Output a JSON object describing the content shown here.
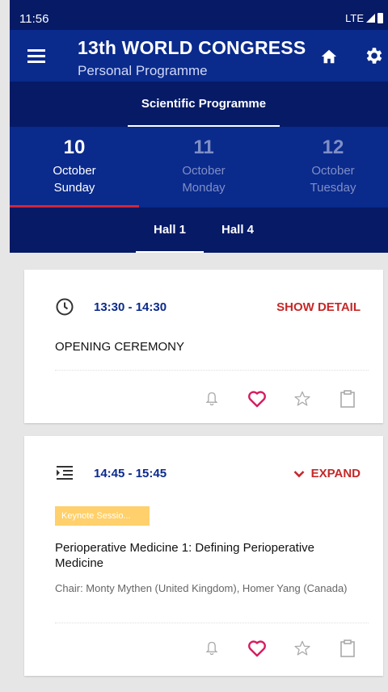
{
  "status": {
    "time": "11:56",
    "network": "LTE"
  },
  "app": {
    "title": "13th WORLD CONGRESS",
    "subtitle": "Personal Programme"
  },
  "tabs": {
    "main": "Scientific Programme"
  },
  "dates": [
    {
      "num": "10",
      "month": "October",
      "day": "Sunday"
    },
    {
      "num": "11",
      "month": "October",
      "day": "Monday"
    },
    {
      "num": "12",
      "month": "October",
      "day": "Tuesday"
    }
  ],
  "halls": [
    "Hall 1",
    "Hall 4"
  ],
  "sessions": [
    {
      "time": "13:30 - 14:30",
      "action": "SHOW DETAIL",
      "title": "OPENING CEREMONY"
    },
    {
      "time": "14:45 - 15:45",
      "action": "EXPAND",
      "badge": "Keynote Sessio...",
      "title": "Perioperative Medicine 1: Defining Perioperative Medicine",
      "chair": "Chair: Monty Mythen (United Kingdom), Homer Yang (Canada)"
    }
  ],
  "colors": {
    "primary": "#0a2a8c",
    "dark": "#061a66",
    "accent": "#c62828",
    "heart": "#d81b60",
    "badge": "#ffd06b"
  },
  "icons": {
    "card1_leading": "clock-icon",
    "card2_leading": "indent-list-icon",
    "bell": "bell-icon",
    "heart": "heart-icon",
    "star": "star-icon",
    "clipboard": "clipboard-icon"
  }
}
